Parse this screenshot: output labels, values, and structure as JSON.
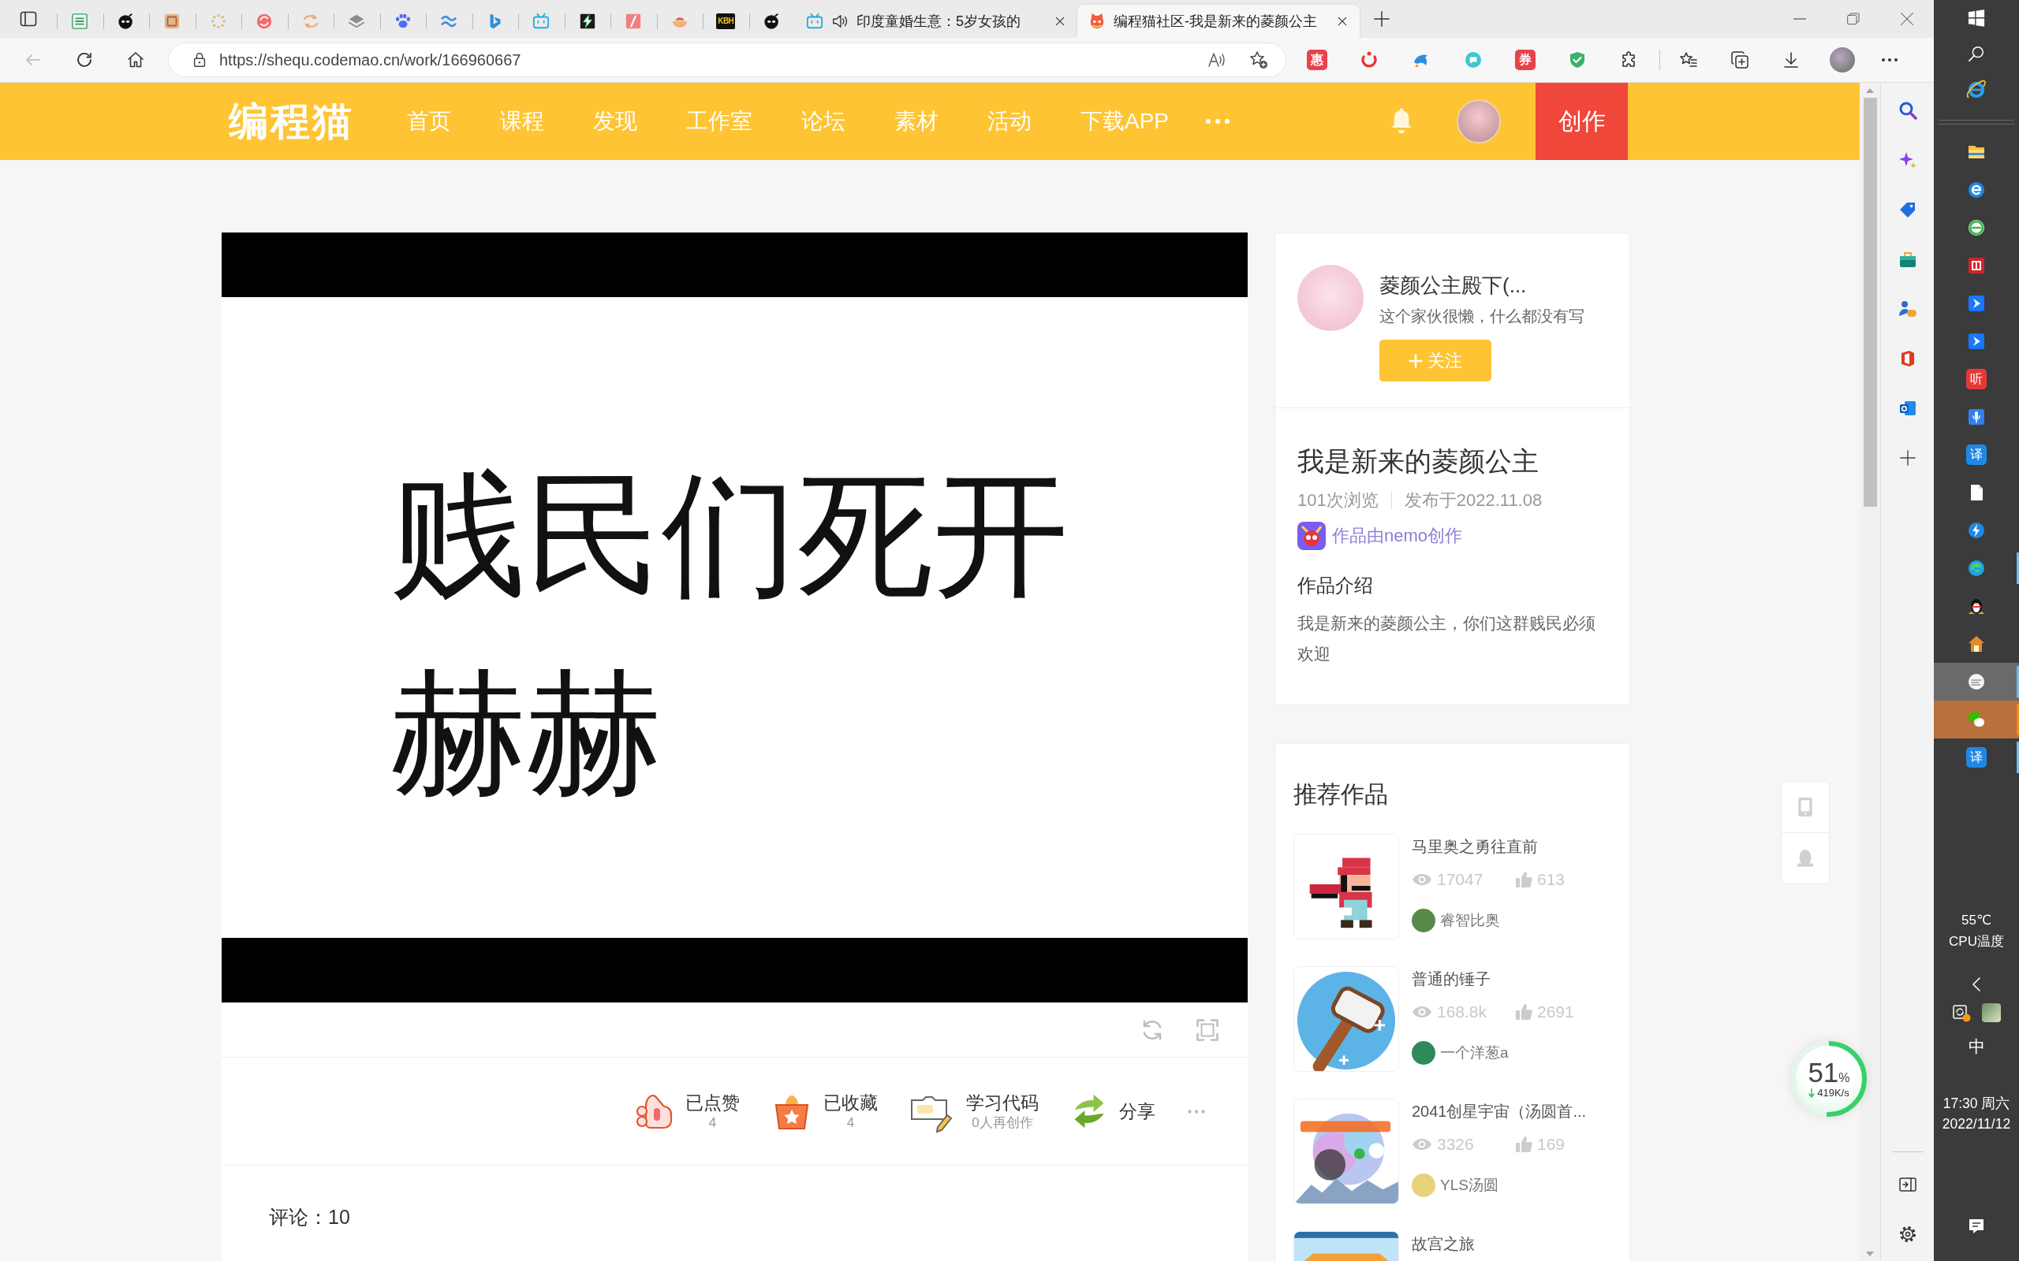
{
  "browser": {
    "pinned_tabs": [
      {
        "selected": false
      },
      {
        "selected": false
      },
      {
        "selected": false
      },
      {
        "selected": false
      },
      {
        "selected": false
      },
      {
        "selected": false
      },
      {
        "selected": false
      },
      {
        "selected": false
      },
      {
        "selected": false
      },
      {
        "selected": false
      },
      {
        "selected": false
      },
      {
        "selected": false
      },
      {
        "selected": false
      },
      {
        "selected": false
      },
      {
        "selected": false,
        "label": "KBH"
      },
      {
        "selected": false
      }
    ],
    "tabs": [
      {
        "title": "印度童婚生意：5岁女孩的",
        "audio": true,
        "selected": false
      },
      {
        "title": "编程猫社区-我是新来的菱颜公主",
        "audio": false,
        "selected": true
      }
    ],
    "url": "https://shequ.codemao.cn/work/166960667",
    "extensions": [
      {
        "kind": "text",
        "label": "惠"
      },
      {
        "kind": "icon"
      },
      {
        "kind": "icon"
      },
      {
        "kind": "icon"
      },
      {
        "kind": "text",
        "label": "券"
      },
      {
        "kind": "icon"
      },
      {
        "kind": "icon"
      }
    ]
  },
  "site_nav": {
    "logo": "编程猫",
    "items": [
      {
        "label": "首页",
        "selected": false
      },
      {
        "label": "课程",
        "selected": false
      },
      {
        "label": "发现",
        "selected": false
      },
      {
        "label": "工作室",
        "selected": false
      },
      {
        "label": "论坛",
        "selected": false
      },
      {
        "label": "素材",
        "selected": false
      },
      {
        "label": "活动",
        "selected": false
      },
      {
        "label": "下载APP",
        "selected": false
      }
    ],
    "create_button": "创作"
  },
  "work": {
    "stage_lines": [
      "贱民们死开",
      "赫赫"
    ],
    "actions": [
      {
        "kind": "like",
        "label": "已点赞",
        "count": "4"
      },
      {
        "kind": "collect",
        "label": "已收藏",
        "count": "4"
      },
      {
        "kind": "remix",
        "label": "学习代码",
        "count": "0人再创作"
      },
      {
        "kind": "share",
        "label": "分享"
      }
    ],
    "comments": "评论：10"
  },
  "author": {
    "name": "菱颜公主殿下(...",
    "bio": "这个家伙很懒，什么都没有写",
    "follow_button": "关注"
  },
  "details": {
    "title": "我是新来的菱颜公主",
    "views": "101次浏览",
    "published": "发布于2022.11.08",
    "made_with": "作品由nemo创作",
    "intro_heading": "作品介绍",
    "intro": "我是新来的菱颜公主，你们这群贱民必须欢迎"
  },
  "recommended": {
    "heading": "推荐作品",
    "items": [
      {
        "title": "马里奥之勇往直前",
        "views": "17047",
        "likes": "613",
        "author": "睿智比奥"
      },
      {
        "title": "普通的锤子",
        "views": "168.8k",
        "likes": "2691",
        "author": "一个洋葱a"
      },
      {
        "title": "2041创星宇宙（汤圆首...",
        "views": "3326",
        "likes": "169",
        "author": "YLS汤圆"
      },
      {
        "title": "故宫之旅"
      }
    ]
  },
  "net_meter": {
    "percent": "51",
    "unit": "%",
    "speed": "419K/s",
    "level": 0.51
  },
  "taskbar": {
    "apps": [
      {
        "selected": false,
        "running": false,
        "attention": false
      },
      {
        "selected": false,
        "running": false,
        "attention": false
      },
      {
        "selected": false,
        "running": false,
        "attention": false
      },
      {
        "selected": false,
        "running": false,
        "attention": false
      },
      {
        "selected": false,
        "running": false,
        "attention": false
      },
      {
        "selected": false,
        "running": false,
        "attention": false
      },
      {
        "selected": false,
        "running": false,
        "attention": false,
        "label": "听"
      },
      {
        "selected": false,
        "running": false,
        "attention": false
      },
      {
        "selected": false,
        "running": false,
        "attention": false,
        "label": "译"
      },
      {
        "selected": false,
        "running": false,
        "attention": false
      },
      {
        "selected": false,
        "running": false,
        "attention": false
      },
      {
        "selected": false,
        "running": true,
        "attention": false
      },
      {
        "selected": false,
        "running": false,
        "attention": false
      },
      {
        "selected": false,
        "running": false,
        "attention": false
      },
      {
        "selected": true,
        "running": true,
        "attention": false
      },
      {
        "selected": false,
        "running": true,
        "attention": true
      },
      {
        "selected": false,
        "running": true,
        "attention": false,
        "label": "译"
      }
    ],
    "cpu_temp": "55℃",
    "cpu_label": "CPU温度",
    "ime": "中",
    "time": "17:30 周六",
    "date": "2022/11/12"
  }
}
